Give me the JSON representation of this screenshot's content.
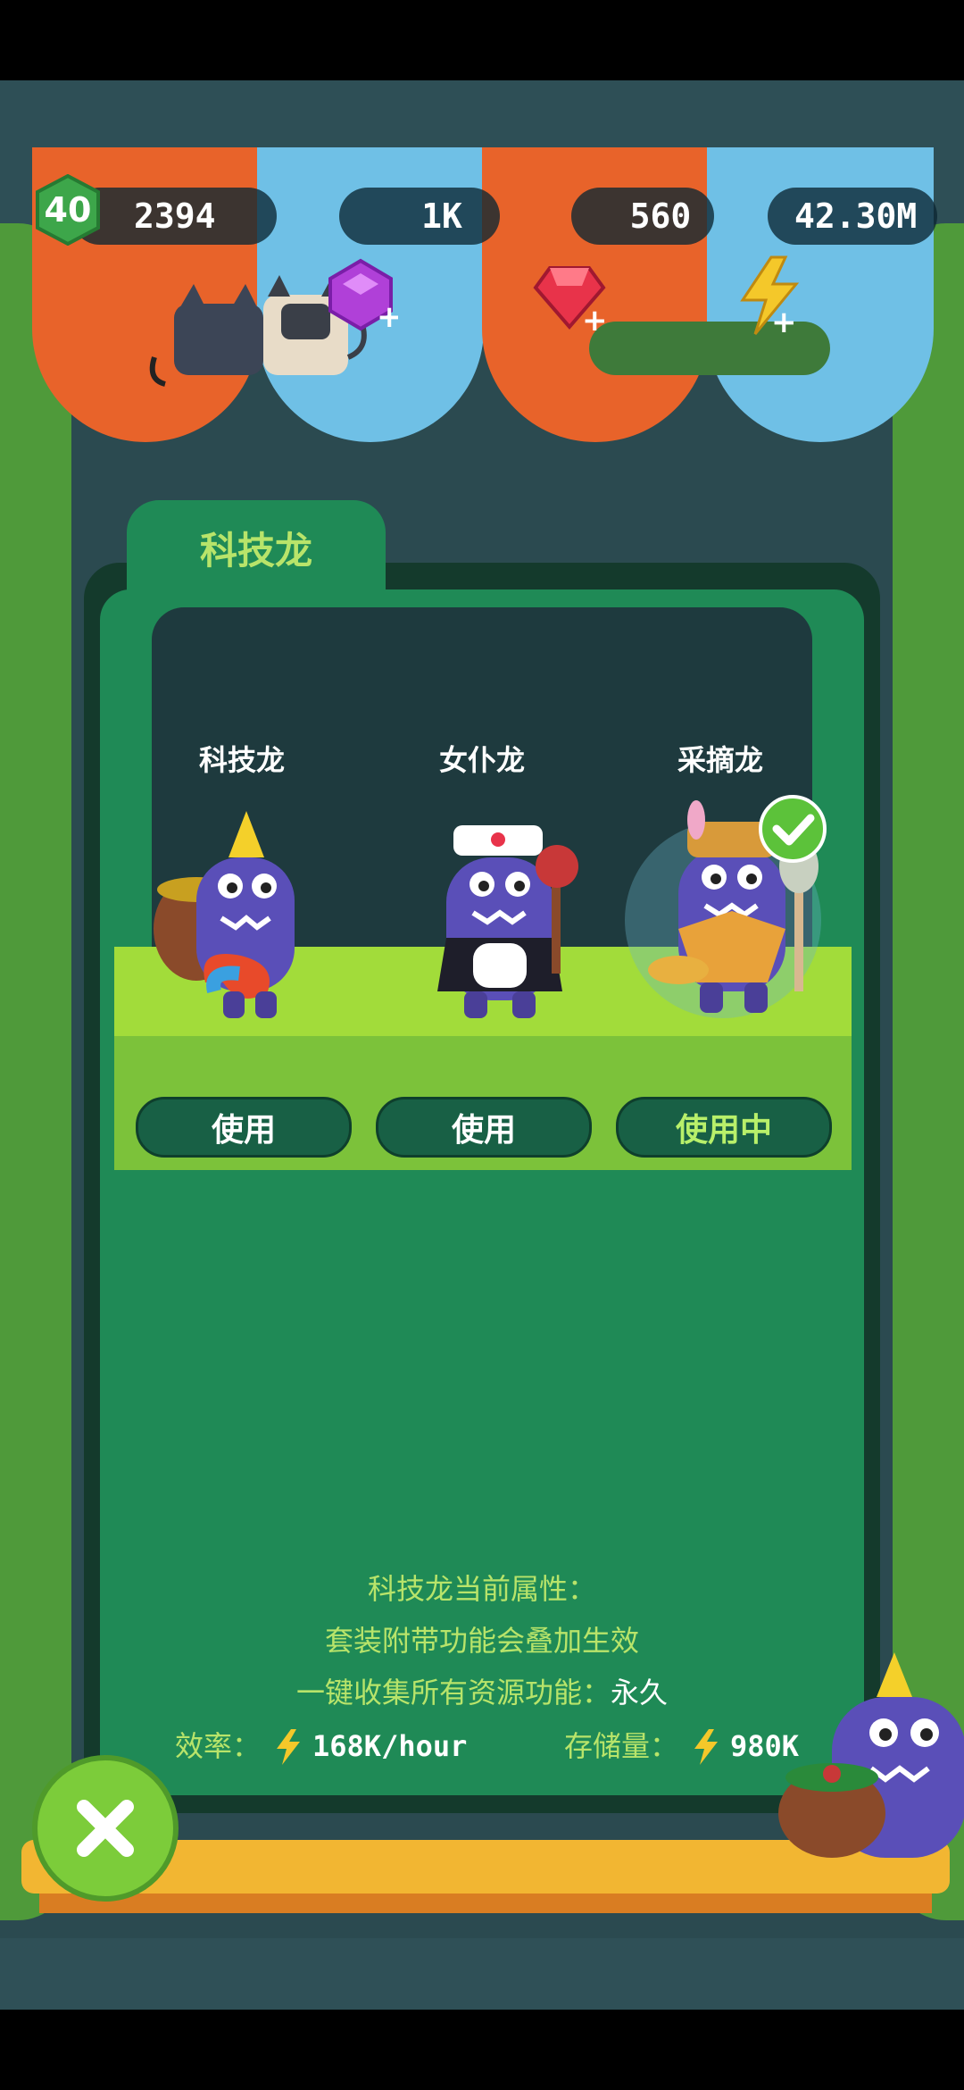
{
  "resources": {
    "level": "40",
    "gold": "2394",
    "gems": "1K",
    "rubies": "560",
    "energy": "42.30M"
  },
  "panel": {
    "tab_label": "科技龙",
    "dragons": [
      {
        "name": "科技龙",
        "button": "使用",
        "selected": false
      },
      {
        "name": "女仆龙",
        "button": "使用",
        "selected": false
      },
      {
        "name": "采摘龙",
        "button": "使用中",
        "selected": true
      }
    ],
    "info": {
      "line1": "科技龙当前属性：",
      "line2": "套装附带功能会叠加生效",
      "line3_label": "一键收集所有资源功能：",
      "line3_value": "永久"
    },
    "stats": {
      "efficiency_label": "效率：",
      "efficiency_value": "168K/hour",
      "storage_label": "存储量：",
      "storage_value": "980K"
    }
  },
  "colors": {
    "awning_orange": "#e8632a",
    "awning_blue": "#6fc0e6",
    "panel_green": "#1f8a56",
    "label_green": "#b8e46a",
    "dragon_purple": "#5a4fb8"
  }
}
